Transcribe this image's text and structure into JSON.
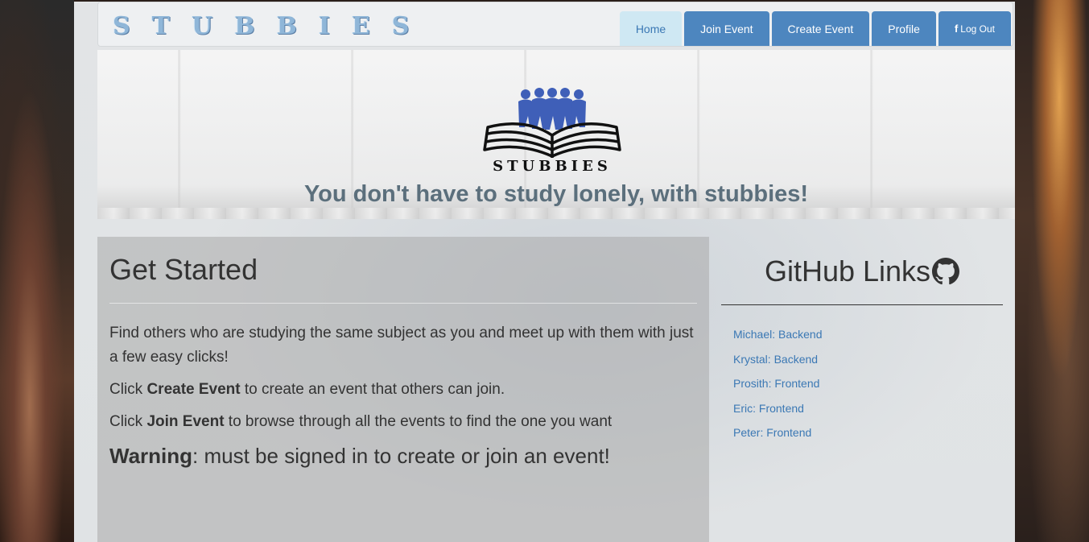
{
  "brand": "STUBBIES",
  "nav": {
    "home": "Home",
    "join_event": "Join Event",
    "create_event": "Create Event",
    "profile": "Profile",
    "logout_icon": "f",
    "logout": "Log Out"
  },
  "hero": {
    "logo_text": "STUBBIES",
    "tagline": "You don't have to study lonely, with stubbies!"
  },
  "get_started": {
    "title": "Get Started",
    "intro": "Find others who are studying the same subject as you and meet up with them with just a few easy clicks!",
    "click1_prefix": "Click ",
    "click1_bold": "Create Event",
    "click1_suffix": " to create an event that others can join.",
    "click2_prefix": "Click ",
    "click2_bold": "Join Event",
    "click2_suffix": " to browse through all the events to find the one you want",
    "warning_bold": "Warning",
    "warning_text": ": must be signed in to create or join an event!"
  },
  "github": {
    "title": "GitHub Links",
    "icon": "github-icon",
    "links": [
      "Michael: Backend",
      "Krystal: Backend",
      "Prosith: Frontend",
      "Eric: Frontend",
      "Peter: Frontend"
    ]
  },
  "colors": {
    "nav_blue": "#4d86bf",
    "nav_active": "#cfe8f3",
    "link": "#3b78b4",
    "tagline": "#5b6f7c"
  }
}
